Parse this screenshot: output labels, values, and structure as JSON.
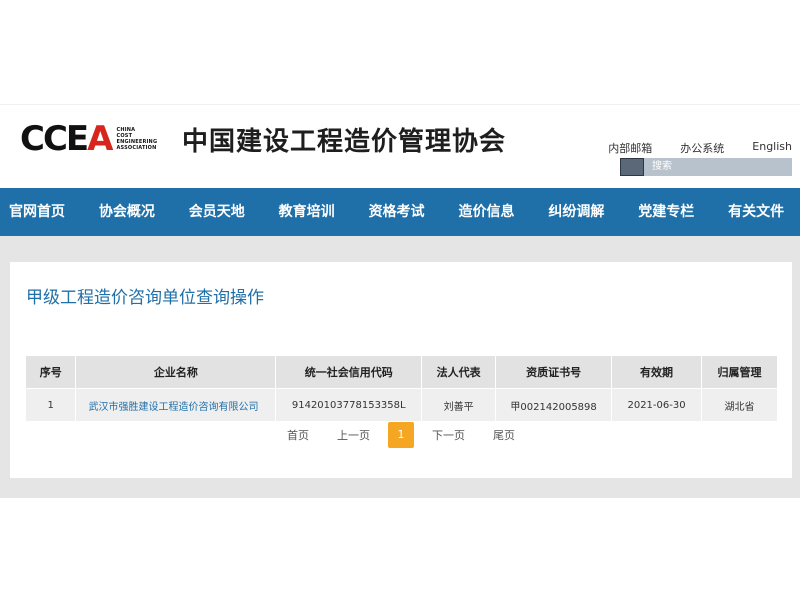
{
  "logo": {
    "mark_part1": "CCE",
    "mark_part2": "A",
    "sub": [
      "CHINA",
      "COST",
      "ENGINEERING",
      "ASSOCIATION"
    ]
  },
  "site_title": "中国建设工程造价管理协会",
  "top_links": [
    "内部邮箱",
    "办公系统",
    "English"
  ],
  "search": {
    "placeholder": "搜索"
  },
  "nav": [
    "官网首页",
    "协会概况",
    "会员天地",
    "教育培训",
    "资格考试",
    "造价信息",
    "纠纷调解",
    "党建专栏",
    "有关文件"
  ],
  "page_title": "甲级工程造价咨询单位查询操作",
  "table": {
    "headers": [
      "序号",
      "企业名称",
      "统一社会信用代码",
      "法人代表",
      "资质证书号",
      "有效期",
      "归属管理"
    ],
    "rows": [
      [
        "1",
        "武汉市强胜建设工程造价咨询有限公司",
        "91420103778153358L",
        "刘善平",
        "甲002142005898",
        "2021-06-30",
        "湖北省"
      ]
    ]
  },
  "pager": {
    "first": "首页",
    "prev": "上一页",
    "current": "1",
    "next": "下一页",
    "last": "尾页"
  },
  "colors": {
    "nav_blue": "#1f6fa8",
    "accent_orange": "#f5a623",
    "logo_red": "#d7261e"
  }
}
